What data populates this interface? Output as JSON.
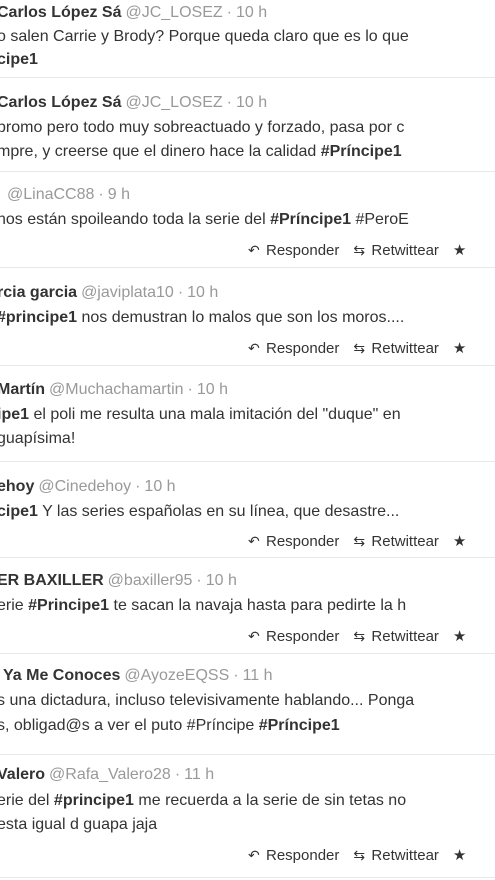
{
  "actions": {
    "reply": "Responder",
    "retweet": "Retwittear"
  },
  "tweets": [
    {
      "name": "Carlos López Sá",
      "handle": "@JC_LOSEZ",
      "time": "10 h",
      "line1": "o salen Carrie y Brody? Porque queda claro que es lo que",
      "line2_pre": "",
      "line2_tag": "cipe1",
      "line2_post": ""
    },
    {
      "name": "Carlos López Sá",
      "handle": "@JC_LOSEZ",
      "time": "10 h",
      "line1": " promo pero todo muy sobreactuado y forzado, pasa por c",
      "line2_pre": "mpre, y creerse que el dinero hace la calidad ",
      "line2_tag": "#Príncipe1",
      "line2_post": ""
    },
    {
      "name": "",
      "handle": "@LinaCC88",
      "time": "9 h",
      "line1_pre": " nos están spoileando toda la serie del ",
      "line1_tag": "#Príncipe1",
      "line1_post": " #PeroE"
    },
    {
      "name": "rcia garcia",
      "handle": "@javiplata10",
      "time": "10 h",
      "line1_pre": "",
      "line1_tag": "#principe1",
      "line1_post": " nos demustran lo malos que son los moros...."
    },
    {
      "name": "Martín",
      "handle": "@Muchachamartin",
      "time": "10 h",
      "line1_pre": "",
      "line1_tag": "ipe1",
      "line1_post": " el poli me resulta una mala imitación del \"duque\" en",
      "line2": " guapísima!"
    },
    {
      "name": "ehoy",
      "handle": "@Cinedehoy",
      "time": "10 h",
      "line1_pre": "",
      "line1_tag": "cipe1",
      "line1_post": " Y las series españolas en su línea, que desastre..."
    },
    {
      "name": "ER BAXILLER",
      "handle": "@baxiller95",
      "time": "10 h",
      "line1_pre": "erie ",
      "line1_tag": "#Principe1",
      "line1_post": " te sacan la navaja hasta para pedirte la h"
    },
    {
      "name": "Ya Me Conoces",
      "handle": "@AyozeEQSS",
      "time": "11 h",
      "line1": "s una dictadura, incluso televisivamente hablando... Ponga",
      "line2_pre": "s, obligad@s a ver el puto #Príncipe ",
      "line2_tag": "#Príncipe1",
      "line2_post": ""
    },
    {
      "name": "Valero",
      "handle": "@Rafa_Valero28",
      "time": "11 h",
      "line1_pre": "erie del ",
      "line1_tag": "#principe1",
      "line1_post": " me recuerda a la serie de sin tetas no",
      "line2": "esta igual d guapa jaja"
    }
  ]
}
